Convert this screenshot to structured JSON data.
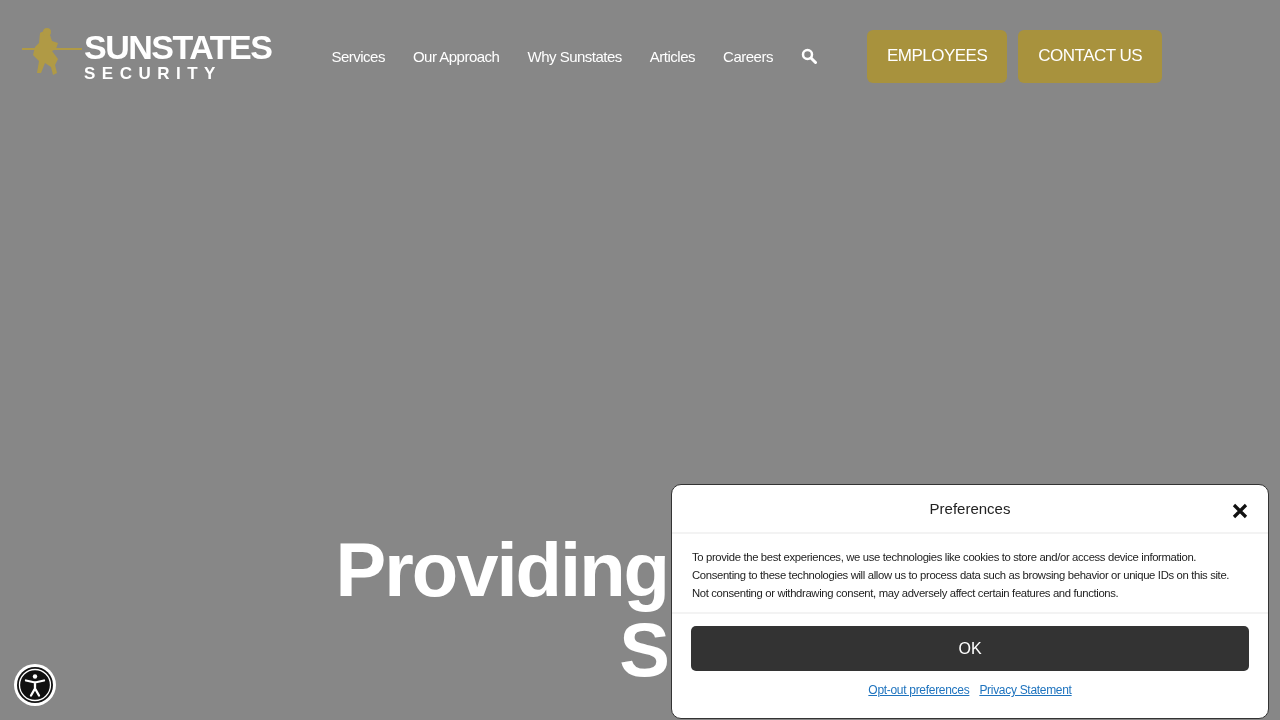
{
  "header": {
    "logo": {
      "title": "SUNSTATES",
      "subtitle": "SECURITY"
    },
    "nav": [
      "Services",
      "Our Approach",
      "Why Sunstates",
      "Articles",
      "Careers"
    ],
    "buttons": [
      "EMPLOYEES",
      "CONTACT US"
    ]
  },
  "hero": {
    "lines": [
      "Providing",
      "S"
    ]
  },
  "consent": {
    "title": "Preferences",
    "body": "To provide the best experiences, we use technologies like cookies to store and/or access device information. Consenting to these technologies will allow us to process data such as browsing behavior or unique IDs on this site. Not consenting or withdrawing consent, may adversely affect certain features and functions.",
    "ok": "OK",
    "links": [
      "Opt-out preferences",
      "Privacy Statement"
    ]
  }
}
